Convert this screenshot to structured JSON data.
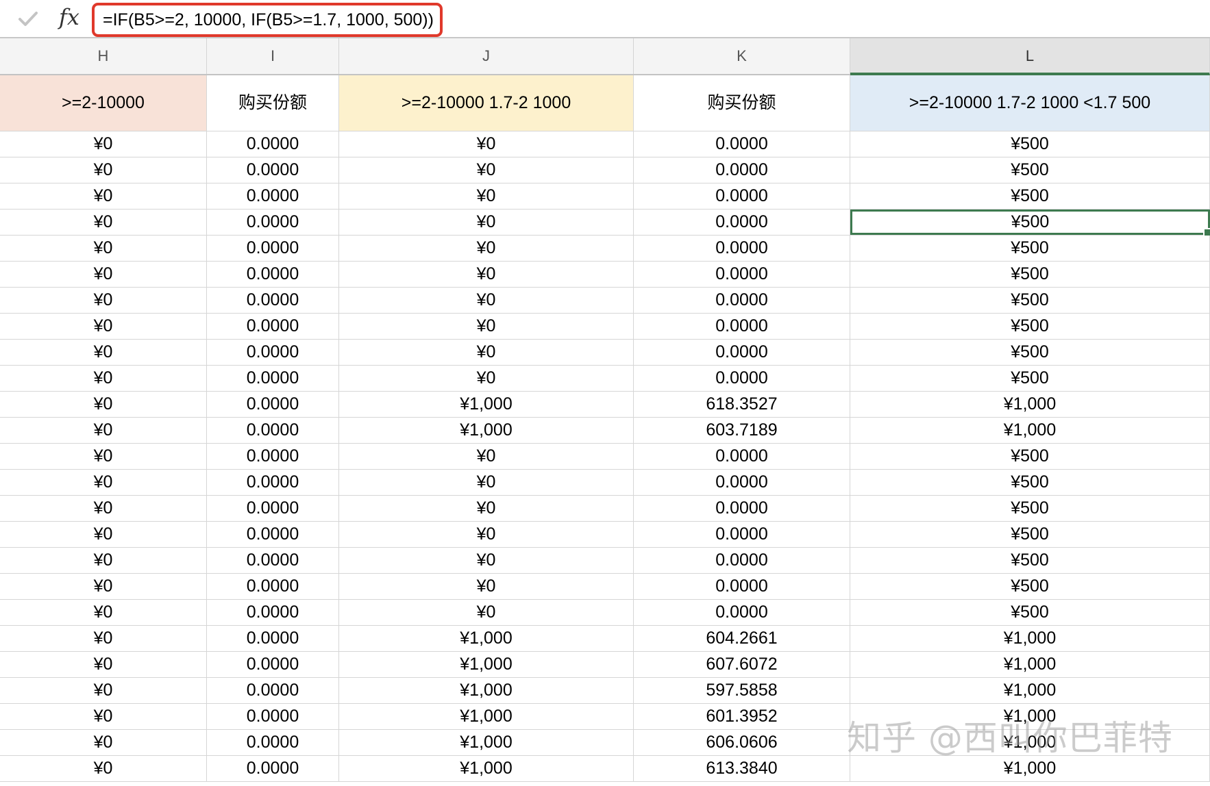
{
  "formula_bar": {
    "formula": "=IF(B5>=2, 10000, IF(B5>=1.7, 1000, 500))",
    "check_icon": "check-icon",
    "fx_label": "fx"
  },
  "columns": [
    {
      "letter": "H",
      "header": ">=2-10000",
      "header_bg": "#f8e2d8"
    },
    {
      "letter": "I",
      "header": "购买份额",
      "header_bg": "#ffffff"
    },
    {
      "letter": "J",
      "header": ">=2-10000 1.7-2 1000",
      "header_bg": "#fdf1cd"
    },
    {
      "letter": "K",
      "header": "购买份额",
      "header_bg": "#ffffff"
    },
    {
      "letter": "L",
      "header": ">=2-10000 1.7-2 1000 <1.7 500",
      "header_bg": "#e0ebf6"
    }
  ],
  "selected_column": "L",
  "selected_row_index": 3,
  "rows": [
    [
      "¥0",
      "0.0000",
      "¥0",
      "0.0000",
      "¥500"
    ],
    [
      "¥0",
      "0.0000",
      "¥0",
      "0.0000",
      "¥500"
    ],
    [
      "¥0",
      "0.0000",
      "¥0",
      "0.0000",
      "¥500"
    ],
    [
      "¥0",
      "0.0000",
      "¥0",
      "0.0000",
      "¥500"
    ],
    [
      "¥0",
      "0.0000",
      "¥0",
      "0.0000",
      "¥500"
    ],
    [
      "¥0",
      "0.0000",
      "¥0",
      "0.0000",
      "¥500"
    ],
    [
      "¥0",
      "0.0000",
      "¥0",
      "0.0000",
      "¥500"
    ],
    [
      "¥0",
      "0.0000",
      "¥0",
      "0.0000",
      "¥500"
    ],
    [
      "¥0",
      "0.0000",
      "¥0",
      "0.0000",
      "¥500"
    ],
    [
      "¥0",
      "0.0000",
      "¥0",
      "0.0000",
      "¥500"
    ],
    [
      "¥0",
      "0.0000",
      "¥1,000",
      "618.3527",
      "¥1,000"
    ],
    [
      "¥0",
      "0.0000",
      "¥1,000",
      "603.7189",
      "¥1,000"
    ],
    [
      "¥0",
      "0.0000",
      "¥0",
      "0.0000",
      "¥500"
    ],
    [
      "¥0",
      "0.0000",
      "¥0",
      "0.0000",
      "¥500"
    ],
    [
      "¥0",
      "0.0000",
      "¥0",
      "0.0000",
      "¥500"
    ],
    [
      "¥0",
      "0.0000",
      "¥0",
      "0.0000",
      "¥500"
    ],
    [
      "¥0",
      "0.0000",
      "¥0",
      "0.0000",
      "¥500"
    ],
    [
      "¥0",
      "0.0000",
      "¥0",
      "0.0000",
      "¥500"
    ],
    [
      "¥0",
      "0.0000",
      "¥0",
      "0.0000",
      "¥500"
    ],
    [
      "¥0",
      "0.0000",
      "¥1,000",
      "604.2661",
      "¥1,000"
    ],
    [
      "¥0",
      "0.0000",
      "¥1,000",
      "607.6072",
      "¥1,000"
    ],
    [
      "¥0",
      "0.0000",
      "¥1,000",
      "597.5858",
      "¥1,000"
    ],
    [
      "¥0",
      "0.0000",
      "¥1,000",
      "601.3952",
      "¥1,000"
    ],
    [
      "¥0",
      "0.0000",
      "¥1,000",
      "606.0606",
      "¥1,000"
    ],
    [
      "¥0",
      "0.0000",
      "¥1,000",
      "613.3840",
      "¥1,000"
    ]
  ],
  "watermark": "知乎 @西叫你巴菲特"
}
